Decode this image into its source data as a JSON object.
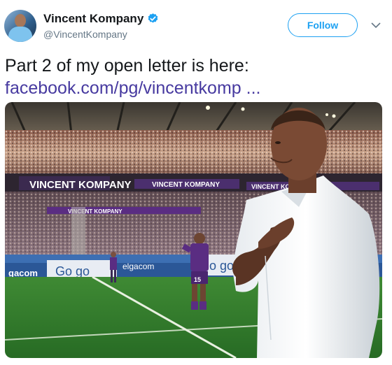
{
  "user": {
    "display_name": "Vincent Kompany",
    "handle": "@VincentKompany",
    "verified_icon": "verified-badge-icon",
    "avatar_icon": "profile-avatar"
  },
  "actions": {
    "follow_label": "Follow",
    "more_icon": "chevron-down-icon"
  },
  "tweet": {
    "text": "Part 2 of my open letter is here:",
    "link_text": "facebook.com/pg/vincentkomp ..."
  },
  "media": {
    "image_icon": "stadium-photo",
    "banner_texts": [
      "VINCENT KOMPANY",
      "VINCENT KOMPANY",
      "VINCENT KOMPANY",
      "VINCENT KOMPANY"
    ],
    "ad_texts": [
      "gacom",
      "Go go",
      "elgacom",
      "Go go"
    ],
    "player_number": "15"
  },
  "colors": {
    "accent": "#1da1f2",
    "link": "#473aa0",
    "text": "#14171a",
    "muted": "#657786",
    "pitch": "#2f7a2e",
    "banner": "#5a2d82"
  }
}
